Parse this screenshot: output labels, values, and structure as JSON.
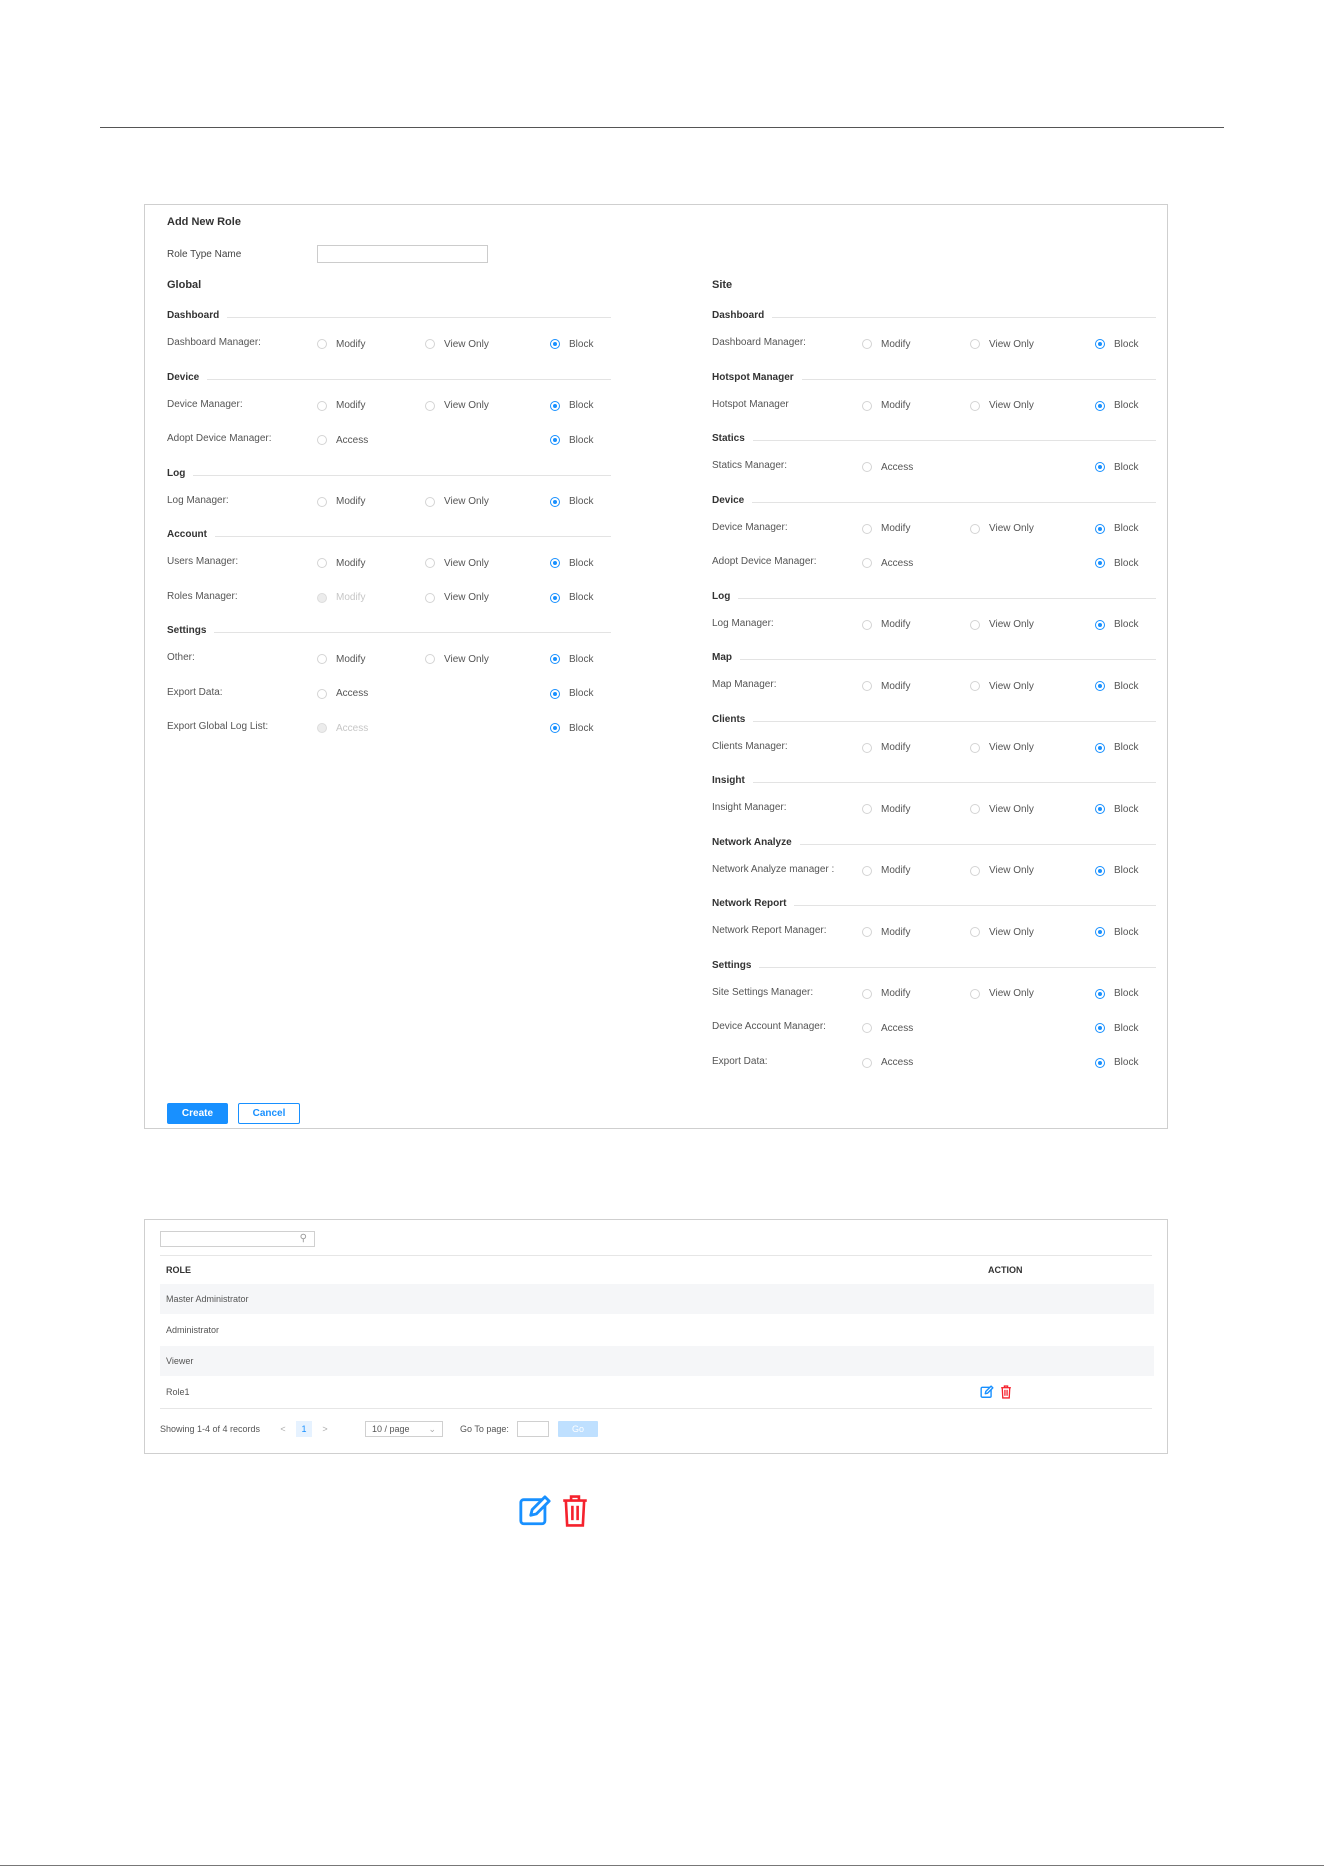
{
  "form": {
    "title": "Add New Role",
    "role_type_name_label": "Role Type Name",
    "role_type_name_value": "",
    "global": {
      "title": "Global",
      "sections": [
        {
          "title": "Dashboard",
          "rows": [
            {
              "label": "Dashboard Manager:",
              "options": [
                "Modify",
                "View Only",
                "Block"
              ],
              "selected": "Block"
            }
          ]
        },
        {
          "title": "Device",
          "rows": [
            {
              "label": "Device Manager:",
              "options": [
                "Modify",
                "View Only",
                "Block"
              ],
              "selected": "Block"
            },
            {
              "label": "Adopt Device Manager:",
              "options": [
                "Access",
                "Block"
              ],
              "selected": "Block"
            }
          ]
        },
        {
          "title": "Log",
          "rows": [
            {
              "label": "Log Manager:",
              "options": [
                "Modify",
                "View Only",
                "Block"
              ],
              "selected": "Block"
            }
          ]
        },
        {
          "title": "Account",
          "rows": [
            {
              "label": "Users Manager:",
              "options": [
                "Modify",
                "View Only",
                "Block"
              ],
              "selected": "Block"
            },
            {
              "label": "Roles Manager:",
              "options": [
                "Modify",
                "View Only",
                "Block"
              ],
              "selected": "Block",
              "disabled": [
                "Modify"
              ]
            }
          ]
        },
        {
          "title": "Settings",
          "rows": [
            {
              "label": "Other:",
              "options": [
                "Modify",
                "View Only",
                "Block"
              ],
              "selected": "Block"
            },
            {
              "label": "Export Data:",
              "options": [
                "Access",
                "Block"
              ],
              "selected": "Block"
            },
            {
              "label": "Export Global Log List:",
              "options": [
                "Access",
                "Block"
              ],
              "selected": "Block",
              "disabled": [
                "Access"
              ]
            }
          ]
        }
      ]
    },
    "site": {
      "title": "Site",
      "sections": [
        {
          "title": "Dashboard",
          "rows": [
            {
              "label": "Dashboard Manager:",
              "options": [
                "Modify",
                "View Only",
                "Block"
              ],
              "selected": "Block"
            }
          ]
        },
        {
          "title": "Hotspot Manager",
          "rows": [
            {
              "label": "Hotspot Manager",
              "options": [
                "Modify",
                "View Only",
                "Block"
              ],
              "selected": "Block"
            }
          ]
        },
        {
          "title": "Statics",
          "rows": [
            {
              "label": "Statics Manager:",
              "options": [
                "Access",
                "Block"
              ],
              "selected": "Block"
            }
          ]
        },
        {
          "title": "Device",
          "rows": [
            {
              "label": "Device Manager:",
              "options": [
                "Modify",
                "View Only",
                "Block"
              ],
              "selected": "Block"
            },
            {
              "label": "Adopt Device Manager:",
              "options": [
                "Access",
                "Block"
              ],
              "selected": "Block"
            }
          ]
        },
        {
          "title": "Log",
          "rows": [
            {
              "label": "Log Manager:",
              "options": [
                "Modify",
                "View Only",
                "Block"
              ],
              "selected": "Block"
            }
          ]
        },
        {
          "title": "Map",
          "rows": [
            {
              "label": "Map Manager:",
              "options": [
                "Modify",
                "View Only",
                "Block"
              ],
              "selected": "Block"
            }
          ]
        },
        {
          "title": "Clients",
          "rows": [
            {
              "label": "Clients Manager:",
              "options": [
                "Modify",
                "View Only",
                "Block"
              ],
              "selected": "Block"
            }
          ]
        },
        {
          "title": "Insight",
          "rows": [
            {
              "label": "Insight Manager:",
              "options": [
                "Modify",
                "View Only",
                "Block"
              ],
              "selected": "Block"
            }
          ]
        },
        {
          "title": "Network Analyze",
          "rows": [
            {
              "label": "Network Analyze manager :",
              "options": [
                "Modify",
                "View Only",
                "Block"
              ],
              "selected": "Block"
            }
          ]
        },
        {
          "title": "Network Report",
          "rows": [
            {
              "label": "Network Report Manager:",
              "options": [
                "Modify",
                "View Only",
                "Block"
              ],
              "selected": "Block"
            }
          ]
        },
        {
          "title": "Settings",
          "rows": [
            {
              "label": "Site Settings Manager:",
              "options": [
                "Modify",
                "View Only",
                "Block"
              ],
              "selected": "Block"
            },
            {
              "label": "Device Account Manager:",
              "options": [
                "Access",
                "Block"
              ],
              "selected": "Block"
            },
            {
              "label": "Export Data:",
              "options": [
                "Access",
                "Block"
              ],
              "selected": "Block"
            }
          ]
        }
      ]
    },
    "create_label": "Create",
    "cancel_label": "Cancel"
  },
  "table": {
    "search_placeholder": "",
    "search_icon": "search-icon",
    "columns": {
      "role": "ROLE",
      "action": "ACTION"
    },
    "rows": [
      {
        "role": "Master Administrator",
        "actions": false
      },
      {
        "role": "Administrator",
        "actions": false
      },
      {
        "role": "Viewer",
        "actions": false
      },
      {
        "role": "Role1",
        "actions": true
      }
    ],
    "pagination": {
      "showing": "Showing 1-4 of 4 records",
      "prev": "<",
      "current_page": "1",
      "next": ">",
      "page_size": "10 / page",
      "goto_label": "Go To page:",
      "go_label": "Go"
    }
  },
  "colors": {
    "accent": "#1890ff",
    "edit_icon": "#1890ff",
    "delete_icon": "#f5222d"
  },
  "legend_icons": [
    "edit-icon",
    "delete-icon"
  ]
}
